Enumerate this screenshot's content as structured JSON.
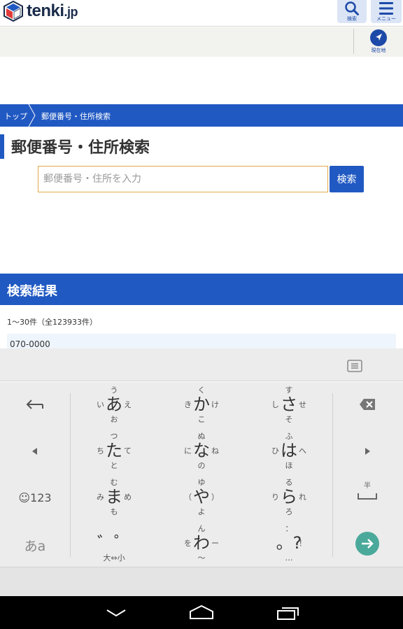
{
  "header": {
    "logo_text": "tenki",
    "logo_suffix": ".jp",
    "search_label": "検索",
    "menu_label": "メニュー"
  },
  "subbar": {
    "location_label": "現在地"
  },
  "breadcrumb": {
    "home": "トップ",
    "current": "郵便番号・住所検索"
  },
  "page_title": "郵便番号・住所検索",
  "search": {
    "placeholder": "郵便番号・住所を入力",
    "value": "",
    "button_label": "検索"
  },
  "results": {
    "title": "検索結果",
    "count": "1〜30件（全123933件）",
    "rows": [
      "070-0000"
    ]
  },
  "keyboard": {
    "keys": [
      {
        "c": "あ",
        "u": "う",
        "d": "お",
        "l": "い",
        "r": "え"
      },
      {
        "c": "か",
        "u": "く",
        "d": "こ",
        "l": "き",
        "r": "け"
      },
      {
        "c": "さ",
        "u": "す",
        "d": "そ",
        "l": "し",
        "r": "せ"
      },
      {
        "c": "た",
        "u": "つ",
        "d": "と",
        "l": "ち",
        "r": "て"
      },
      {
        "c": "な",
        "u": "ぬ",
        "d": "の",
        "l": "に",
        "r": "ね"
      },
      {
        "c": "は",
        "u": "ふ",
        "d": "ほ",
        "l": "ひ",
        "r": "へ"
      },
      {
        "c": "ま",
        "u": "む",
        "d": "も",
        "l": "み",
        "r": "め"
      },
      {
        "c": "や",
        "u": "ゆ",
        "d": "よ",
        "l": "（",
        "r": "）"
      },
      {
        "c": "ら",
        "u": "る",
        "d": "ろ",
        "l": "り",
        "r": "れ"
      },
      {
        "c": "゛゜",
        "u": "",
        "d": "大⇔小",
        "l": "",
        "r": ""
      },
      {
        "c": "わ",
        "u": "ん",
        "d": "〜",
        "l": "を",
        "r": "ー"
      },
      {
        "c": "。?",
        "u": "：",
        "d": "…",
        "l": "",
        "r": "！"
      }
    ],
    "emoji_label": "☺123",
    "mode_label": "あa",
    "half_width_label": "半",
    "colors": {
      "accent": "#4aa99a",
      "brand": "#2159c3"
    }
  }
}
